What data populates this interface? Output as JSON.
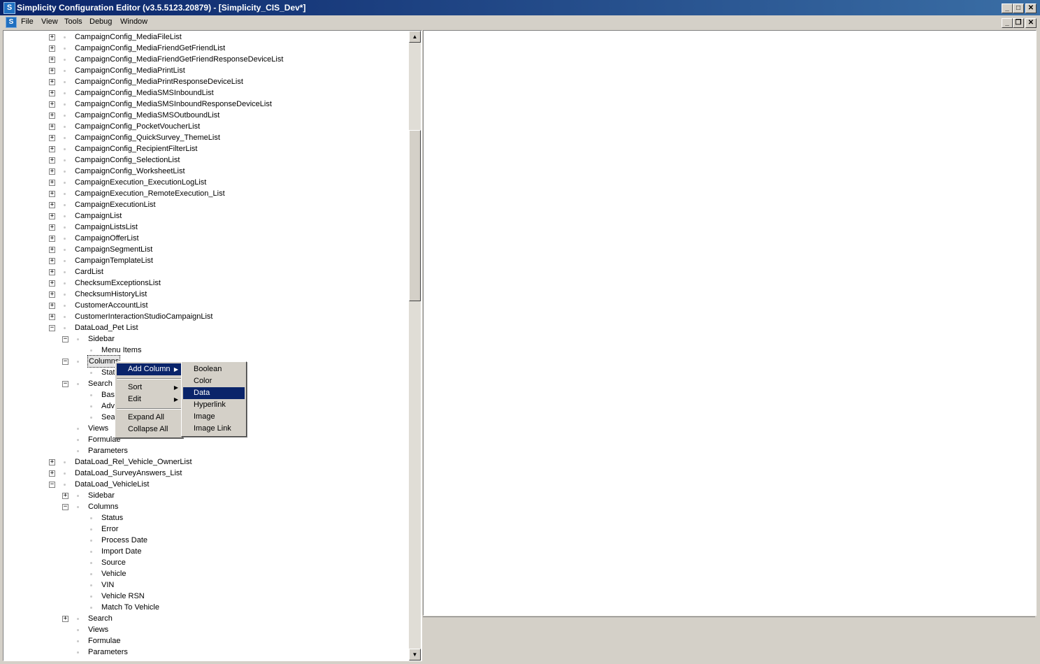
{
  "window": {
    "title": "Simplicity Configuration Editor (v3.5.5123.20879) - [Simplicity_CIS_Dev*]",
    "app_icon_letter": "S",
    "minimize_glyph": "_",
    "maximize_glyph": "□",
    "close_glyph": "✕",
    "restore_glyph": "❐"
  },
  "menubar": {
    "items": [
      "File",
      "View",
      "Tools",
      "Debug",
      "Window"
    ]
  },
  "tree": {
    "items": [
      {
        "label": "CampaignConfig_MediaFileList",
        "exp": "+"
      },
      {
        "label": "CampaignConfig_MediaFriendGetFriendList",
        "exp": "+"
      },
      {
        "label": "CampaignConfig_MediaFriendGetFriendResponseDeviceList",
        "exp": "+"
      },
      {
        "label": "CampaignConfig_MediaPrintList",
        "exp": "+"
      },
      {
        "label": "CampaignConfig_MediaPrintResponseDeviceList",
        "exp": "+"
      },
      {
        "label": "CampaignConfig_MediaSMSInboundList",
        "exp": "+"
      },
      {
        "label": "CampaignConfig_MediaSMSInboundResponseDeviceList",
        "exp": "+"
      },
      {
        "label": "CampaignConfig_MediaSMSOutboundList",
        "exp": "+"
      },
      {
        "label": "CampaignConfig_PocketVoucherList",
        "exp": "+"
      },
      {
        "label": "CampaignConfig_QuickSurvey_ThemeList",
        "exp": "+"
      },
      {
        "label": "CampaignConfig_RecipientFilterList",
        "exp": "+"
      },
      {
        "label": "CampaignConfig_SelectionList",
        "exp": "+"
      },
      {
        "label": "CampaignConfig_WorksheetList",
        "exp": "+"
      },
      {
        "label": "CampaignExecution_ExecutionLogList",
        "exp": "+"
      },
      {
        "label": "CampaignExecution_RemoteExecution_List",
        "exp": "+"
      },
      {
        "label": "CampaignExecutionList",
        "exp": "+"
      },
      {
        "label": "CampaignList",
        "exp": "+"
      },
      {
        "label": "CampaignListsList",
        "exp": "+"
      },
      {
        "label": "CampaignOfferList",
        "exp": "+"
      },
      {
        "label": "CampaignSegmentList",
        "exp": "+"
      },
      {
        "label": "CampaignTemplateList",
        "exp": "+"
      },
      {
        "label": "CardList",
        "exp": "+"
      },
      {
        "label": "ChecksumExceptionsList",
        "exp": "+"
      },
      {
        "label": "ChecksumHistoryList",
        "exp": "+"
      },
      {
        "label": "CustomerAccountList",
        "exp": "+"
      },
      {
        "label": "CustomerInteractionStudioCampaignList",
        "exp": "+"
      },
      {
        "label": "DataLoad_Pet List",
        "exp": "-"
      },
      {
        "label": "Sidebar",
        "exp": "-",
        "level": 1
      },
      {
        "label": "Menu Items",
        "level": 2
      },
      {
        "label": "Columns",
        "exp": "-",
        "level": 1,
        "selected": true
      },
      {
        "label": "Stat",
        "level": 2
      },
      {
        "label": "Search",
        "exp": "-",
        "level": 1
      },
      {
        "label": "Bas",
        "level": 2
      },
      {
        "label": "Adv",
        "level": 2
      },
      {
        "label": "Sea",
        "level": 2
      },
      {
        "label": "Views",
        "level": 1
      },
      {
        "label": "Formulae",
        "level": 1
      },
      {
        "label": "Parameters",
        "level": 1
      },
      {
        "label": "DataLoad_Rel_Vehicle_OwnerList",
        "exp": "+"
      },
      {
        "label": "DataLoad_SurveyAnswers_List",
        "exp": "+"
      },
      {
        "label": "DataLoad_VehicleList",
        "exp": "-"
      },
      {
        "label": "Sidebar",
        "exp": "+",
        "level": 1
      },
      {
        "label": "Columns",
        "exp": "-",
        "level": 1
      },
      {
        "label": "Status",
        "level": 2
      },
      {
        "label": "Error",
        "level": 2
      },
      {
        "label": "Process Date",
        "level": 2
      },
      {
        "label": "Import Date",
        "level": 2
      },
      {
        "label": "Source",
        "level": 2
      },
      {
        "label": "Vehicle",
        "level": 2
      },
      {
        "label": "VIN",
        "level": 2
      },
      {
        "label": "Vehicle RSN",
        "level": 2
      },
      {
        "label": "Match To Vehicle",
        "level": 2
      },
      {
        "label": "Search",
        "exp": "+",
        "level": 1
      },
      {
        "label": "Views",
        "level": 1
      },
      {
        "label": "Formulae",
        "level": 1
      },
      {
        "label": "Parameters",
        "level": 1
      }
    ]
  },
  "scrollbar": {
    "up_glyph": "▲",
    "down_glyph": "▼",
    "position_fraction": 0.2,
    "visible_fraction": 0.28
  },
  "context_menu": {
    "add_column": "Add Column",
    "sort": "Sort",
    "edit": "Edit",
    "expand_all": "Expand All",
    "collapse_all": "Collapse All",
    "arrow": "▶"
  },
  "submenu": {
    "items": [
      "Boolean",
      "Color",
      "Data",
      "Hyperlink",
      "Image",
      "Image Link"
    ],
    "highlighted": "Data"
  },
  "colors": {
    "titlebar": "#0a246a",
    "highlight": "#0a246a",
    "face": "#d4d0c8"
  }
}
